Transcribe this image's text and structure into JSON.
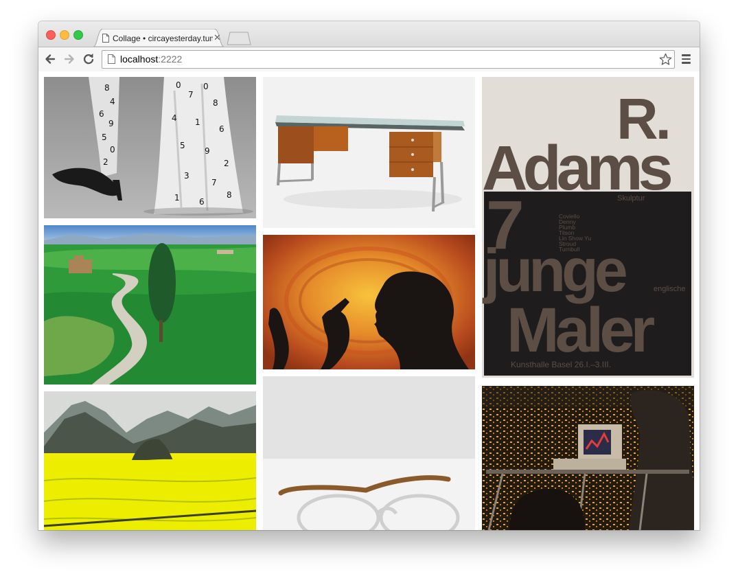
{
  "browser": {
    "tab_title": "Collage • circayesterday.tumblr.com",
    "url_host": "localhost",
    "url_port": ":2222"
  },
  "collage": {
    "poster": {
      "line1": "R.",
      "line2": "Adams",
      "line3": "7",
      "line4": "junge",
      "line5": "Maler",
      "skulptur": "Skulptur",
      "englische": "englische",
      "artists": [
        "Coviello",
        "Denny",
        "Plumb",
        "Tilson",
        "Lin Show Yu",
        "Stroud",
        "Turnbull"
      ],
      "footer": "Kunsthalle Basel 26.I.–3.III."
    },
    "images": [
      {
        "name": "fashion-shoes-photo"
      },
      {
        "name": "glass-desk-photo"
      },
      {
        "name": "tuscany-landscape-photo"
      },
      {
        "name": "silhouette-profile-photo"
      },
      {
        "name": "rapeseed-field-mountains-photo"
      },
      {
        "name": "eyeglasses-photo"
      },
      {
        "name": "vintage-computer-night-office-photo"
      }
    ]
  },
  "colors": {
    "poster_brown": "#5c4d45",
    "poster_dark": "#1f1c1d",
    "poster_bg": "#e2ddd6"
  }
}
